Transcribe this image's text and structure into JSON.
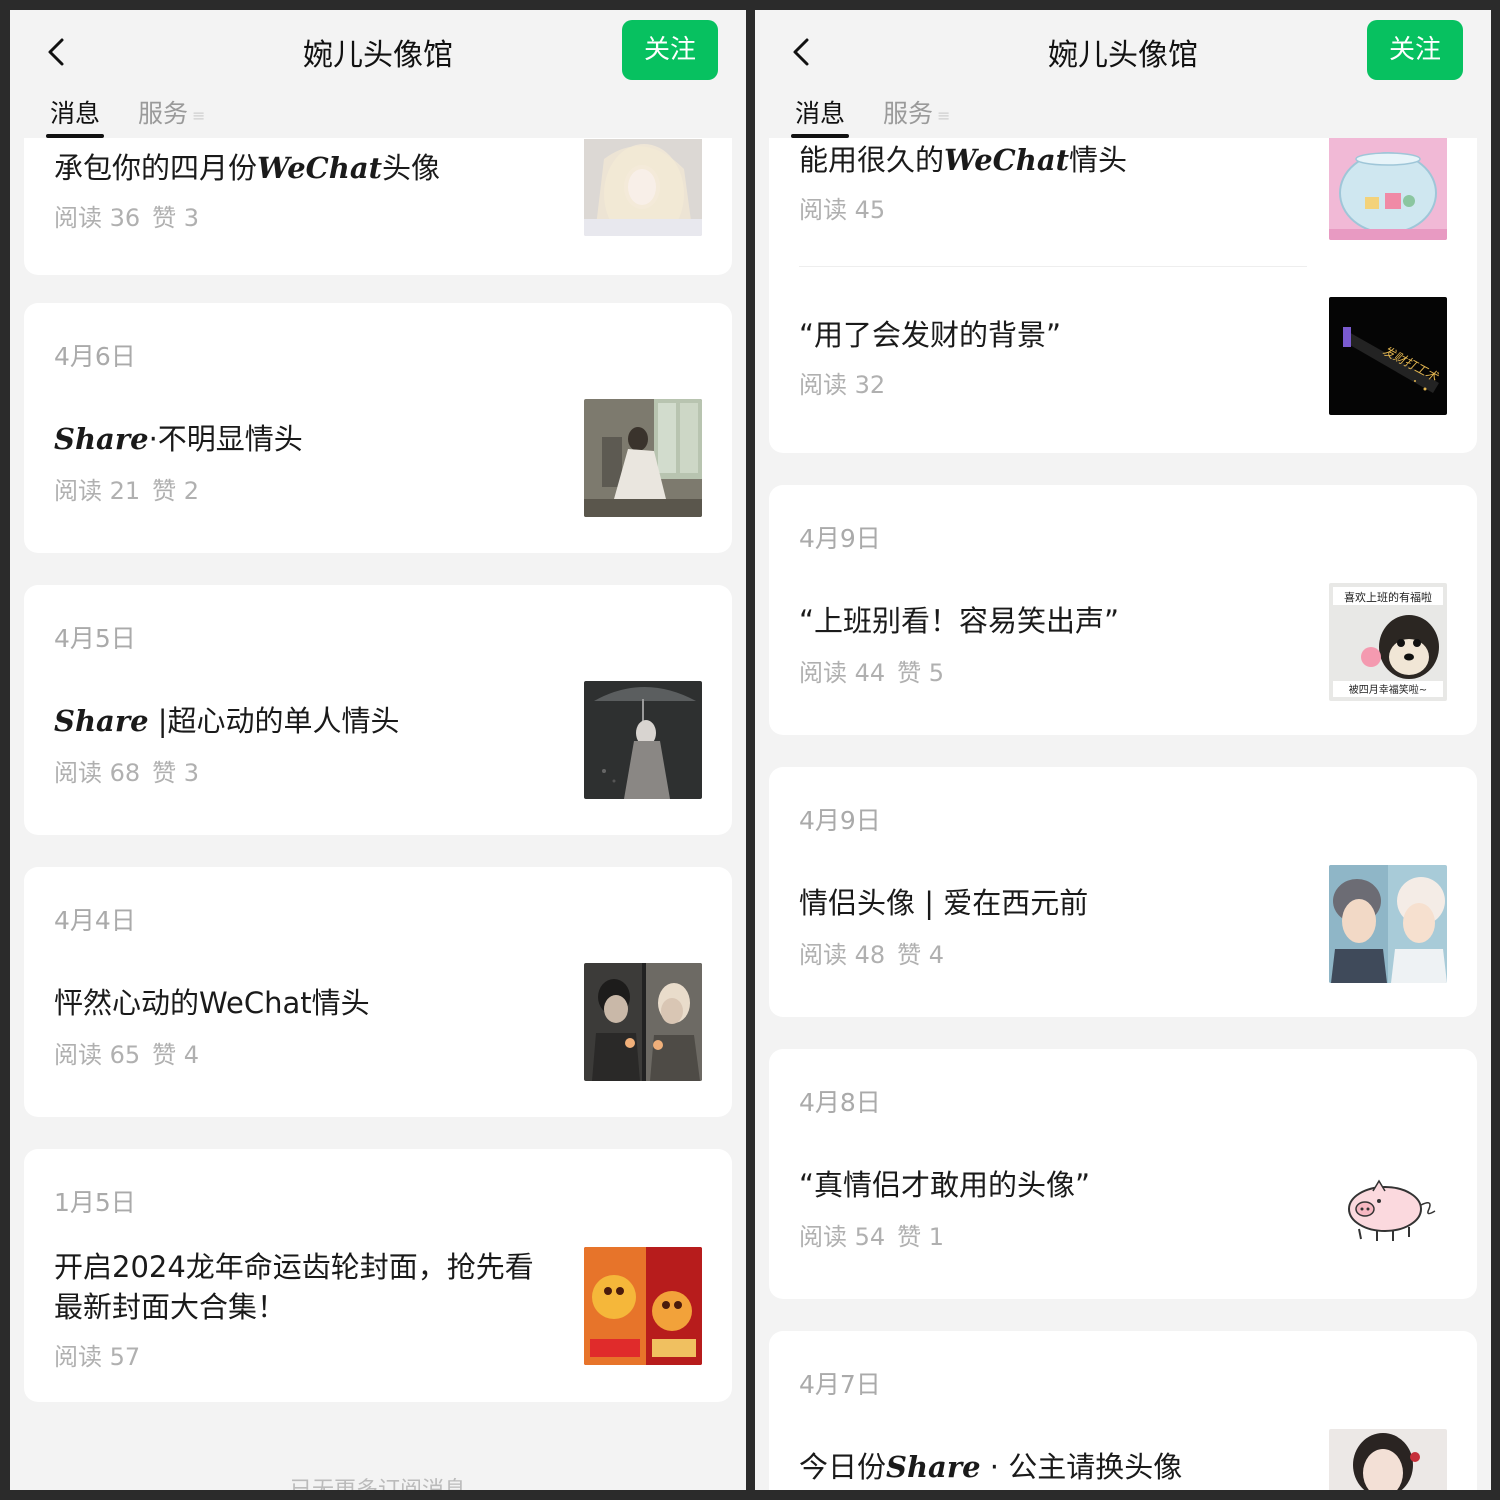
{
  "left": {
    "header": {
      "title": "婉儿头像馆",
      "follow_label": "关注"
    },
    "tabs": {
      "messages": "消息",
      "services": "服务"
    },
    "cards": [
      {
        "title": "承包你的四月份",
        "title_it": "WeChat",
        "title_after": "头像",
        "reads": "阅读 36",
        "likes": "赞 3"
      },
      {
        "date": "4月6日",
        "title_it": "Share",
        "title_after": "·不明显情头",
        "reads": "阅读 21",
        "likes": "赞 2"
      },
      {
        "date": "4月5日",
        "title_it": "Share",
        "title_after": " |超心动的单人情头",
        "reads": "阅读 68",
        "likes": "赞 3"
      },
      {
        "date": "4月4日",
        "title": "怦然心动的WeChat情头",
        "reads": "阅读 65",
        "likes": "赞 4"
      },
      {
        "date": "1月5日",
        "title": "开启2024龙年命运齿轮封面，抢先看最新封面大合集！",
        "reads": "阅读 57"
      }
    ],
    "footer": "已无更多订阅消息"
  },
  "right": {
    "header": {
      "title": "婉儿头像馆",
      "follow_label": "关注"
    },
    "tabs": {
      "messages": "消息",
      "services": "服务"
    },
    "cards": [
      {
        "title": "能用很久的",
        "title_it": "WeChat",
        "title_after": "情头",
        "reads": "阅读 45"
      },
      {
        "title": "“用了会发财的背景”",
        "reads": "阅读 32"
      },
      {
        "date": "4月9日",
        "title": "“上班别看！容易笑出声”",
        "reads": "阅读 44",
        "likes": "赞 5"
      },
      {
        "date": "4月9日",
        "title": "情侣头像 | 爱在西元前",
        "reads": "阅读 48",
        "likes": "赞 4"
      },
      {
        "date": "4月8日",
        "title": "“真情侣才敢用的头像”",
        "reads": "阅读 54",
        "likes": "赞 1"
      },
      {
        "date": "4月7日",
        "title": "今日份",
        "title_it": "Share",
        "title_after": " · 公主请换头像"
      }
    ],
    "thumb_texts": {
      "fortune": "发财打工术",
      "shiba_top": "喜欢上班的有福啦",
      "shiba_bottom": "被四月幸福笑啦~"
    }
  }
}
